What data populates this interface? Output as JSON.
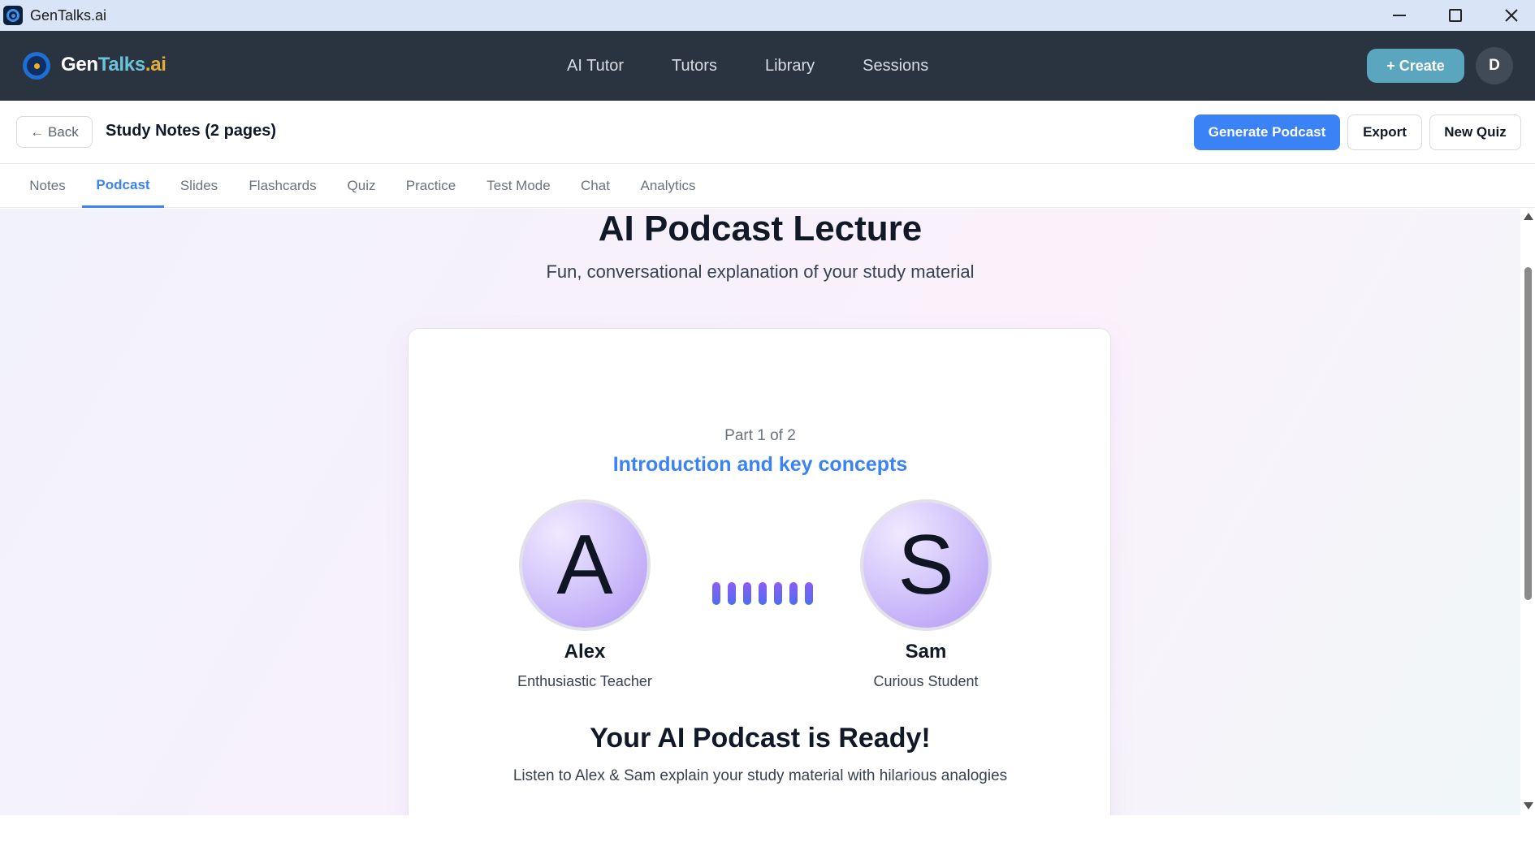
{
  "window": {
    "title": "GenTalks.ai"
  },
  "navbar": {
    "logo": {
      "part1": "Gen",
      "part2": "Talks",
      "part3": ".ai"
    },
    "links": [
      "AI Tutor",
      "Tutors",
      "Library",
      "Sessions"
    ],
    "create_label": "+ Create",
    "avatar_initial": "D"
  },
  "study": {
    "back_label": "← Back",
    "title": "Study Notes (2 pages)",
    "generate_label": "Generate Podcast",
    "export_label": "Export",
    "new_quiz_label": "New Quiz"
  },
  "tabs": [
    {
      "label": "Notes",
      "active": false
    },
    {
      "label": "Podcast",
      "active": true
    },
    {
      "label": "Slides",
      "active": false
    },
    {
      "label": "Flashcards",
      "active": false
    },
    {
      "label": "Quiz",
      "active": false
    },
    {
      "label": "Practice",
      "active": false
    },
    {
      "label": "Test Mode",
      "active": false
    },
    {
      "label": "Chat",
      "active": false
    },
    {
      "label": "Analytics",
      "active": false
    }
  ],
  "podcast": {
    "title": "AI Podcast Lecture",
    "subtitle": "Fun, conversational explanation of your study material",
    "part_label": "Part 1 of 2",
    "part_title": "Introduction and key concepts",
    "speakers": [
      {
        "initial": "A",
        "name": "Alex",
        "role": "Enthusiastic Teacher"
      },
      {
        "initial": "S",
        "name": "Sam",
        "role": "Curious Student"
      }
    ],
    "ready_title": "Your AI Podcast is Ready!",
    "ready_subtitle": "Listen to Alex & Sam explain your study material with hilarious analogies"
  },
  "colors": {
    "navbar_bg": "#2a3340",
    "accent_blue": "#3b82f6",
    "create_teal": "#5aa6bf",
    "avatar_purple": "#b096f4",
    "wave_purple": "#8b5cf6"
  },
  "icons": {
    "app": "gentalks-logo-icon",
    "minimize": "minimize-icon",
    "maximize": "maximize-icon",
    "close": "close-icon",
    "audio": "audio-wave-icon"
  }
}
